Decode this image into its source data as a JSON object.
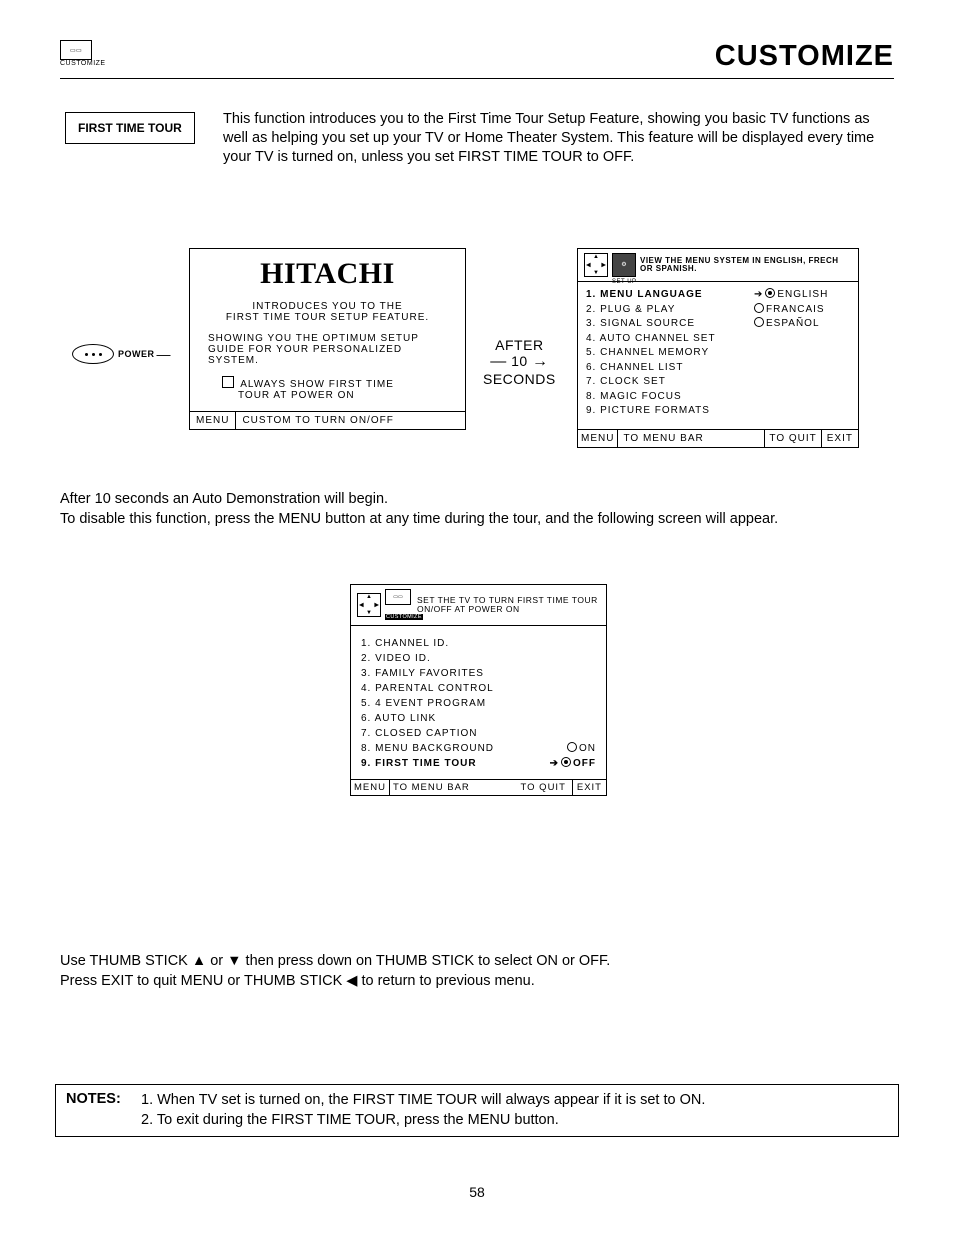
{
  "header": {
    "icon_label": "CUSTOMIZE",
    "page_title": "CUSTOMIZE"
  },
  "section": {
    "box_label": "FIRST TIME TOUR",
    "intro": "This function introduces you to the First Time Tour Setup Feature, showing you basic TV functions as well as helping you set up your TV or Home Theater System.  This feature will be displayed every time your TV is turned on, unless you set FIRST TIME TOUR to OFF."
  },
  "power_label": "POWER",
  "hitachi": {
    "logo": "HITACHI",
    "para1a": "INTRODUCES YOU TO THE",
    "para1b": "FIRST TIME TOUR SETUP FEATURE.",
    "para2": "SHOWING YOU THE OPTIMUM SETUP GUIDE FOR YOUR PERSONALIZED SYSTEM.",
    "check_line1": "ALWAYS SHOW FIRST TIME",
    "check_line2": "TOUR AT POWER ON",
    "foot_a": "MENU",
    "foot_b": "CUSTOM TO TURN ON/OFF"
  },
  "between": {
    "l1": "AFTER",
    "l2": "10",
    "l3": "SECONDS"
  },
  "setup": {
    "head_text": "VIEW THE MENU SYSTEM IN ENGLISH, FRECH OR SPANISH.",
    "icon_sub": "SET UP",
    "items": [
      "1.  MENU LANGUAGE",
      "2.  PLUG & PLAY",
      "3.  SIGNAL SOURCE",
      "4.  AUTO CHANNEL SET",
      "5.  CHANNEL MEMORY",
      "6.  CHANNEL LIST",
      "7.  CLOCK SET",
      "8.  MAGIC FOCUS",
      "9. PICTURE FORMATS"
    ],
    "langs": [
      "ENGLISH",
      "FRANCAIS",
      "ESPAÑOL"
    ],
    "foot": {
      "c1": "MENU",
      "c2": "TO MENU BAR",
      "c3": "TO QUIT",
      "c4": "EXIT"
    }
  },
  "mid_text_1": "After 10 seconds an Auto Demonstration will begin.",
  "mid_text_2": "To disable this function, press the MENU button at any time during the tour, and the following screen will appear.",
  "customize": {
    "head_text": "SET THE TV TO TURN FIRST TIME TOUR ON/OFF AT POWER ON",
    "icon_sub": "CUSTOMIZE",
    "items": [
      "1.  CHANNEL ID.",
      "2.  VIDEO ID.",
      "3. FAMILY FAVORITES",
      "4.  PARENTAL CONTROL",
      "5. 4 EVENT PROGRAM",
      "6.  AUTO LINK",
      "7.  CLOSED CAPTION"
    ],
    "item8_label": "8.  MENU BACKGROUND",
    "item8_opt": "ON",
    "item9_label": "9.  FIRST TIME TOUR",
    "item9_opt": "OFF",
    "foot": {
      "c1": "MENU",
      "c2": "TO MENU BAR",
      "c3": "TO QUIT",
      "c4": "EXIT"
    }
  },
  "instructions": {
    "l1": "Use THUMB STICK ▲ or ▼ then press down on THUMB STICK to select ON or OFF.",
    "l2": "Press EXIT to quit MENU or THUMB STICK ◀ to return to previous menu."
  },
  "notes": {
    "label": "NOTES:",
    "n1": "1.  When TV set is turned on, the FIRST TIME TOUR will always appear if it is set to ON.",
    "n2": "2.  To exit during the FIRST TIME TOUR, press the MENU button."
  },
  "page_number": "58"
}
